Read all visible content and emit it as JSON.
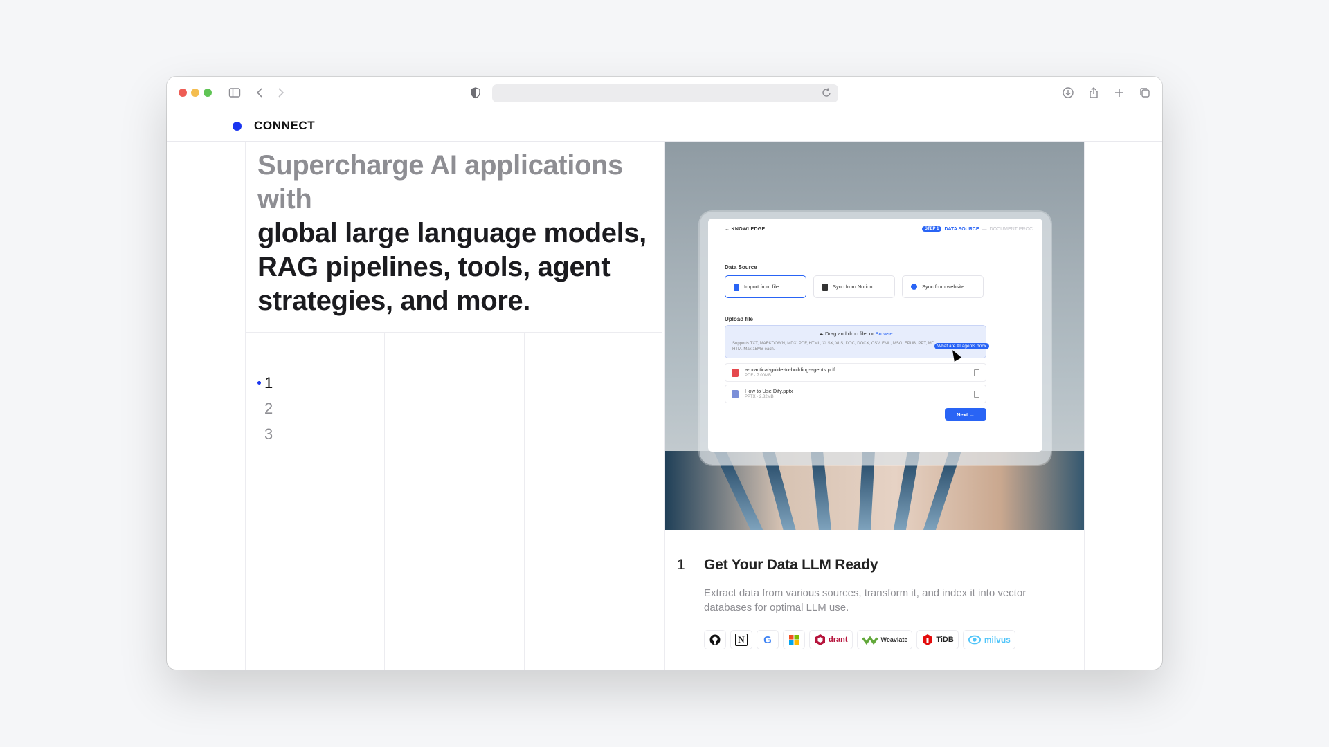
{
  "brand": {
    "name": "CONNECT",
    "accent": "#1a35f0"
  },
  "headline": {
    "muted": "Supercharge AI applications with",
    "dark": "global large language models, RAG pipelines, tools, agent strategies, and more."
  },
  "steps": [
    "1",
    "2",
    "3"
  ],
  "active_step": 0,
  "screen": {
    "back_label": "KNOWLEDGE",
    "step_pill": "STEP 1",
    "step_label": "DATA SOURCE",
    "step_next": "DOCUMENT PROC",
    "data_source_title": "Data Source",
    "sources": [
      "Import from file",
      "Sync from Notion",
      "Sync from website"
    ],
    "upload_title": "Upload file",
    "drop_text": "Drag and drop file, or",
    "browse": "Browse",
    "supports": "Supports TXT, MARKDOWN, MDX, PDF, HTML, XLSX, XLS, DOC, DOCX, CSV, EML, MSG, EPUB, PPT, MD, HTM. Max 15MB each.",
    "drag_chip": "What are AI agents.docx",
    "files": [
      {
        "name": "a-practical-guide-to-building-agents.pdf",
        "meta": "PDF · 7.00MB",
        "color": "#e5484d"
      },
      {
        "name": "How to Use Dify.pptx",
        "meta": "PPTX · 2.82MB",
        "color": "#7b8fd8"
      }
    ],
    "next_label": "Next →"
  },
  "feature": {
    "number": "1",
    "title": "Get Your Data LLM Ready",
    "description": "Extract data from various sources, transform it, and index it into vector databases for optimal LLM use."
  },
  "logos": [
    {
      "name": "github",
      "label": ""
    },
    {
      "name": "notion",
      "label": "N"
    },
    {
      "name": "google",
      "label": "G"
    },
    {
      "name": "microsoft",
      "label": ""
    },
    {
      "name": "qdrant",
      "label": "drant"
    },
    {
      "name": "weaviate",
      "label": "Weaviate"
    },
    {
      "name": "tidb",
      "label": "TiDB"
    },
    {
      "name": "milvus",
      "label": "milvus"
    }
  ]
}
